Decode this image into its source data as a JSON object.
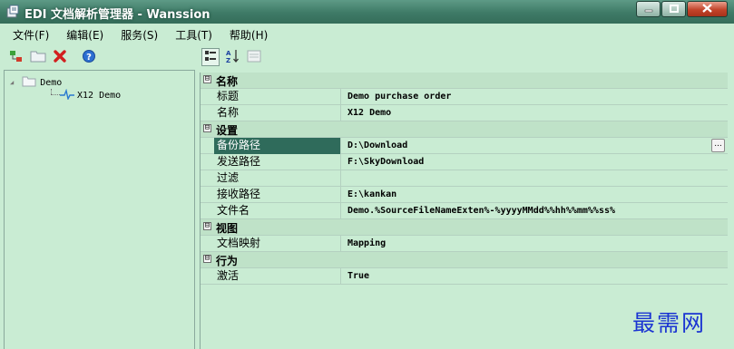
{
  "window": {
    "title": "EDI 文档解析管理器 - Wanssion",
    "controls": {
      "minimize_icon": "minimize-icon",
      "maximize_icon": "maximize-icon",
      "close_icon": "close-icon"
    }
  },
  "menu": {
    "items": [
      {
        "label": "文件(F)"
      },
      {
        "label": "编辑(E)"
      },
      {
        "label": "服务(S)"
      },
      {
        "label": "工具(T)"
      },
      {
        "label": "帮助(H)"
      }
    ]
  },
  "toolbar_left": {
    "icons": [
      "add-node-icon",
      "folder-icon",
      "delete-icon",
      "help-icon"
    ]
  },
  "toolbar_right": {
    "icons": [
      "categorized-view-icon",
      "alphabetical-sort-icon",
      "property-pages-icon"
    ]
  },
  "tree": {
    "root": {
      "label": "Demo",
      "icon": "folder-icon"
    },
    "child": {
      "label": "X12 Demo",
      "icon": "pulse-icon"
    }
  },
  "property_grid": {
    "categories": [
      {
        "label": "名称",
        "rows": [
          {
            "name": "标题",
            "value": "Demo purchase order"
          },
          {
            "name": "名称",
            "value": "X12 Demo"
          }
        ]
      },
      {
        "label": "设置",
        "rows": [
          {
            "name": "备份路径",
            "value": "D:\\Download",
            "selected": true
          },
          {
            "name": "发送路径",
            "value": "F:\\SkyDownload"
          },
          {
            "name": "过滤",
            "value": ""
          },
          {
            "name": "接收路径",
            "value": "E:\\kankan"
          },
          {
            "name": "文件名",
            "value": "Demo.%SourceFileNameExten%-%yyyyMMdd%%hh%%mm%%ss%"
          }
        ]
      },
      {
        "label": "视图",
        "rows": [
          {
            "name": "文档映射",
            "value": "Mapping"
          }
        ]
      },
      {
        "label": "行为",
        "rows": [
          {
            "name": "激活",
            "value": "True"
          }
        ]
      }
    ],
    "toggle_glyph": "⊟",
    "ellipsis_label": "..."
  },
  "watermark": {
    "text": "最需网"
  },
  "colors": {
    "background": "#c9ecd3",
    "titlebar": "#3e7a66",
    "selected_row": "#2f6b5b",
    "watermark": "#1a34d2"
  }
}
